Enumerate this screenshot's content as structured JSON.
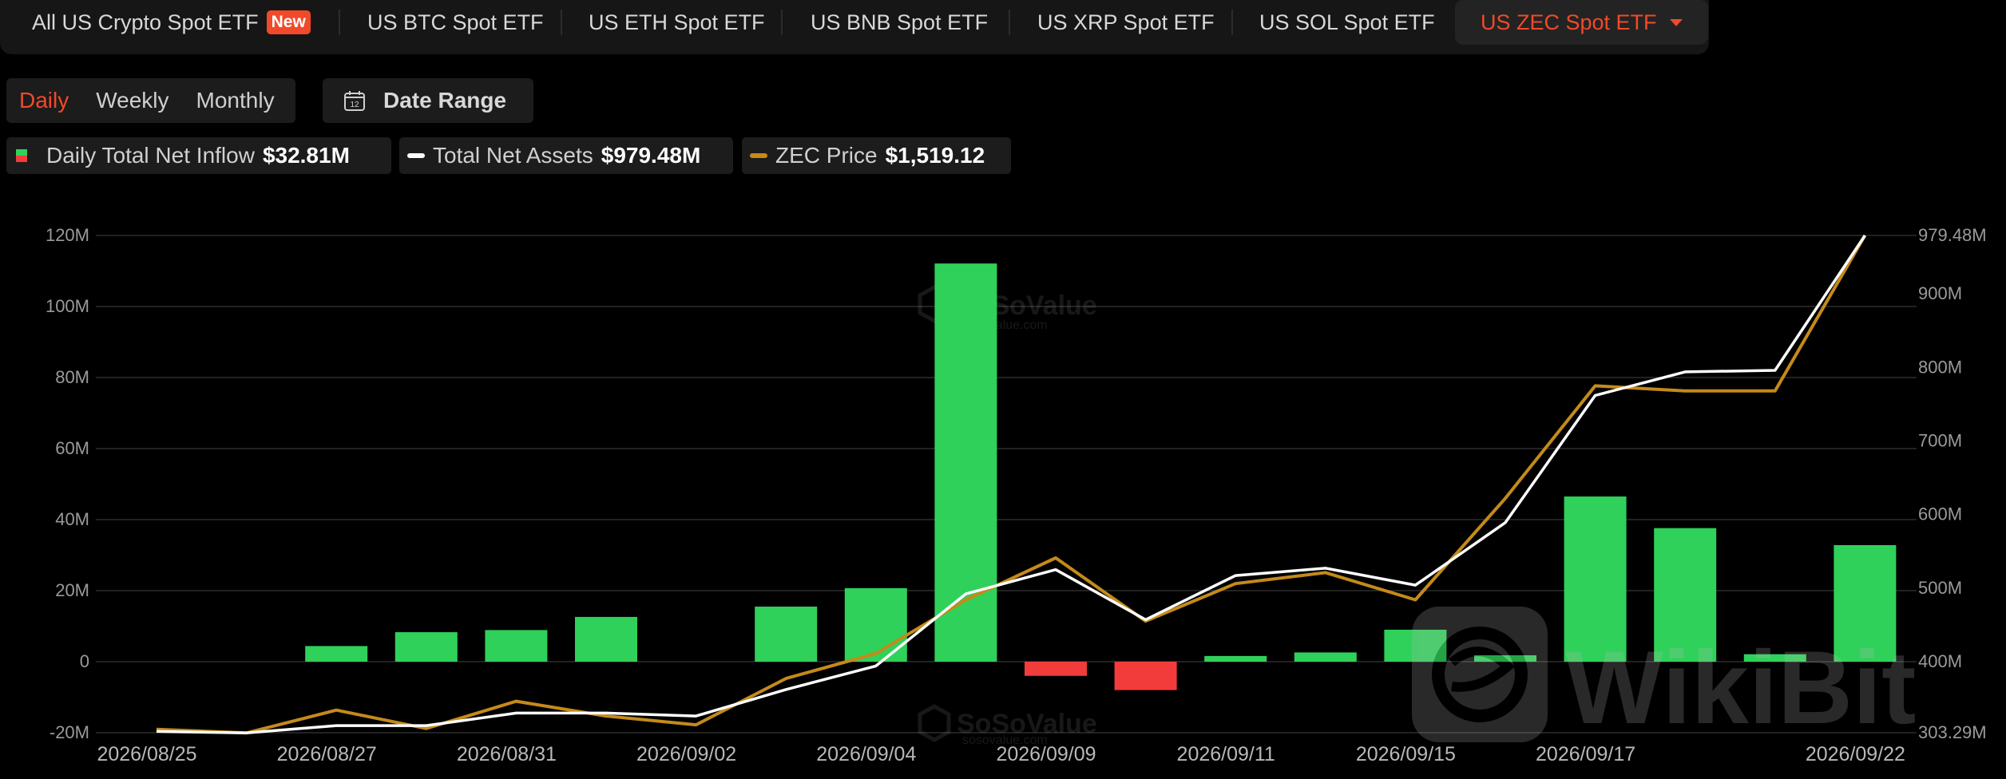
{
  "tabs": [
    {
      "label": "All US Crypto Spot ETF",
      "badge": "New"
    },
    {
      "label": "US BTC Spot ETF"
    },
    {
      "label": "US ETH Spot ETF"
    },
    {
      "label": "US BNB Spot ETF"
    },
    {
      "label": "US XRP Spot ETF"
    },
    {
      "label": "US SOL Spot ETF"
    },
    {
      "label": "US ZEC Spot ETF",
      "active": true
    }
  ],
  "period": {
    "daily": "Daily",
    "weekly": "Weekly",
    "monthly": "Monthly",
    "selected": "Daily"
  },
  "date_range": {
    "label": "Date Range",
    "icon": "calendar-icon",
    "icon_text": "12"
  },
  "legend": {
    "inflow": {
      "label": "Daily Total Net Inflow",
      "value": "$32.81M"
    },
    "assets": {
      "label": "Total Net Assets",
      "value": "$979.48M"
    },
    "price": {
      "label": "ZEC Price",
      "value": "$1,519.12"
    }
  },
  "colors": {
    "accent": "#f04a2a",
    "positive": "#2fd15a",
    "negative": "#f23b3b",
    "assets_line": "#ffffff",
    "price_line": "#c48a1a"
  },
  "watermarks": {
    "sosovalue_name": "SoSoValue",
    "sosovalue_url": "sosovalue.com",
    "wikibit": "WikiBit"
  },
  "chart_data": {
    "type": "bar",
    "x_tick_labels": [
      "2026/08/25",
      "2026/08/27",
      "2026/08/31",
      "2026/09/02",
      "2026/09/04",
      "2026/09/09",
      "2026/09/11",
      "2026/09/15",
      "2026/09/17",
      "2026/09/22"
    ],
    "left_axis": {
      "ticks": [
        "-20M",
        "0",
        "20M",
        "40M",
        "60M",
        "80M",
        "100M",
        "120M"
      ],
      "ylim": [
        -20,
        120
      ],
      "unit": "M"
    },
    "right_axis": {
      "ticks": [
        "303.29M",
        "400M",
        "500M",
        "600M",
        "700M",
        "800M",
        "900M",
        "979.48M"
      ],
      "ylim": [
        303.29,
        979.48
      ],
      "unit": "M"
    },
    "grid": true,
    "series": [
      {
        "name": "Daily Total Net Inflow",
        "type": "bar",
        "axis": "left",
        "values": [
          0,
          0,
          4.4,
          8.3,
          8.9,
          12.6,
          0,
          15.5,
          20.7,
          112.1,
          -4,
          -8,
          1.6,
          2.6,
          9,
          1.8,
          46.5,
          37.6,
          2.1,
          32.81
        ]
      },
      {
        "name": "Total Net Assets",
        "type": "line",
        "axis": "right",
        "values": [
          305,
          303,
          313,
          313,
          330,
          330,
          326,
          362,
          394,
          492,
          525,
          457,
          517,
          527,
          504,
          589,
          762,
          794,
          796,
          979.48
        ]
      },
      {
        "name": "ZEC Price",
        "type": "line",
        "axis": "right",
        "right_axis_ylim": [
          303.29,
          979.48
        ],
        "values": [
          308,
          303,
          334,
          309,
          346,
          326,
          314,
          377,
          411,
          484,
          541,
          455,
          506,
          521,
          484,
          622,
          775,
          768,
          768,
          979.48
        ]
      }
    ]
  }
}
